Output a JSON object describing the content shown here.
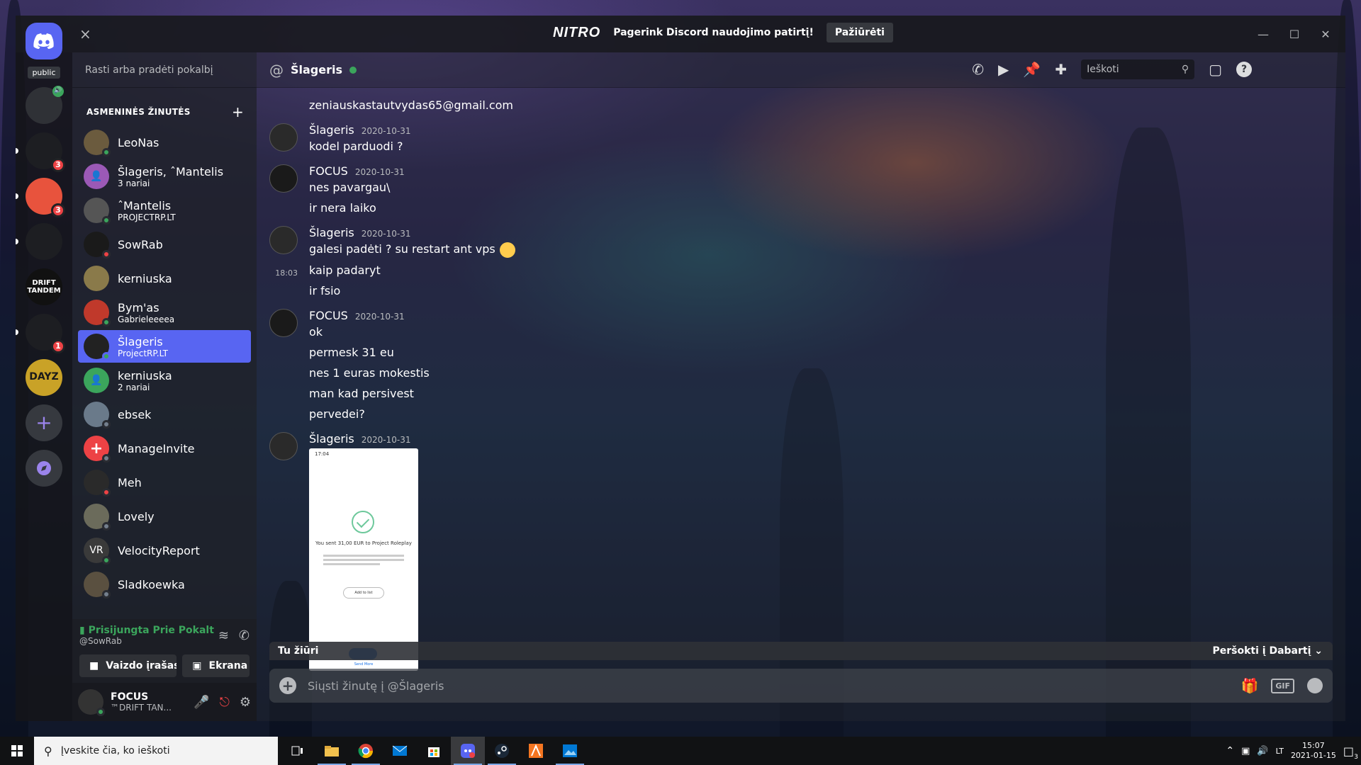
{
  "titlebar": {
    "nitro_logo": "NITRO",
    "nitro_promo": "Pagerink Discord naudojimo patirtį!",
    "nitro_button": "Pažiūrėti",
    "close_banner": "×"
  },
  "rail": {
    "public_label": "public",
    "servers": [
      {
        "name": "server-1",
        "badge": "",
        "color": "#2f3136"
      },
      {
        "name": "server-2",
        "badge": "3",
        "color": "#1d1e22"
      },
      {
        "name": "server-3",
        "badge": "3",
        "color": "#e8533d"
      },
      {
        "name": "server-4",
        "badge": "",
        "color": "#1d1e22"
      },
      {
        "name": "server-drift-tandem",
        "label": "DRIFT TANDEM",
        "badge": "",
        "color": "#111111"
      },
      {
        "name": "server-6",
        "badge": "1",
        "color": "#1d1e22"
      },
      {
        "name": "server-dayz",
        "label": "DAYZ",
        "badge": "",
        "color": "#c9a227"
      }
    ],
    "add_label": "+"
  },
  "dm": {
    "search_placeholder": "Rasti arba pradėti pokalbį",
    "header": "ASMENINĖS ŽINUTĖS",
    "items": [
      {
        "name": "LeoNas",
        "sub": "",
        "status": "online",
        "color": "#6b5b3e"
      },
      {
        "name": "Šlageris, ˆMantelis",
        "sub": "3 nariai",
        "status": "",
        "color": "#9b59b6"
      },
      {
        "name": "ˆMantelis",
        "sub": "PROJECTRP.LT",
        "status": "online",
        "color": "#555555"
      },
      {
        "name": "SowRab",
        "sub": "",
        "status": "dnd",
        "color": "#1a1a1a"
      },
      {
        "name": "kerniuska",
        "sub": "",
        "status": "",
        "color": "#8a7a4a"
      },
      {
        "name": "Bym'as",
        "sub": "Gabrieleeeea",
        "status": "online",
        "color": "#c0392b"
      },
      {
        "name": "Šlageris",
        "sub": "ProjectRP.LT",
        "status": "online",
        "color": "#222222",
        "active": true
      },
      {
        "name": "kerniuska",
        "sub": "2 nariai",
        "status": "",
        "color": "#3ba55c"
      },
      {
        "name": "ebsek",
        "sub": "",
        "status": "offline",
        "color": "#6a7a8a"
      },
      {
        "name": "ManageInvite",
        "sub": "",
        "status": "offline",
        "color": "#ed4245"
      },
      {
        "name": "Meh",
        "sub": "",
        "status": "dnd",
        "color": "#2a2a2a"
      },
      {
        "name": "Lovely",
        "sub": "",
        "status": "offline",
        "color": "#6b6b5b"
      },
      {
        "name": "VelocityReport",
        "sub": "",
        "status": "online",
        "color": "#3a3a3a",
        "initials": "VR"
      },
      {
        "name": "Sladkoewka",
        "sub": "",
        "status": "offline",
        "color": "#5a5040"
      }
    ],
    "voice": {
      "status": "Prisijungta Prie Pokalt",
      "channel": "@SowRab",
      "video_button": "Vaizdo įrašas",
      "screen_button": "Ekrana"
    },
    "user": {
      "name": "FOCUS",
      "tag": "™DRIFT TAN..."
    }
  },
  "chat": {
    "title": "Šlageris",
    "search_placeholder": "Ieškoti",
    "top_line": "zeniauskastautvydas65@gmail.com",
    "groups": [
      {
        "author": "Šlageris",
        "time": "2020-10-31",
        "lines": [
          "kodel parduodi ?"
        ]
      },
      {
        "author": "FOCUS",
        "time": "2020-10-31",
        "lines": [
          "nes pavargau\\",
          "ir nera laiko"
        ]
      },
      {
        "author": "Šlageris",
        "time": "2020-10-31",
        "lines": [
          "galesi padėti ? su restart ant vps",
          "kaip padaryt",
          "ir fsio"
        ],
        "inline_time": "18:03"
      },
      {
        "author": "FOCUS",
        "time": "2020-10-31",
        "lines": [
          "ok",
          "permesk 31 eu",
          "nes 1 euras mokestis",
          "man kad persivest",
          "pervedei?"
        ]
      },
      {
        "author": "Šlageris",
        "time": "2020-10-31",
        "lines": []
      }
    ],
    "attachment": {
      "status_time": "17:04",
      "title": "You sent 31,00 EUR to Project Roleplay",
      "button": "Add to list",
      "link": "Send More"
    },
    "jump_bar": {
      "left": "Tu žiūri",
      "right": "Peršokti į Dabartį"
    },
    "composer_placeholder": "Siųsti žinutę į @Šlageris",
    "gif_label": "GIF"
  },
  "taskbar": {
    "search_placeholder": "Įveskite čia, ko ieškoti",
    "lang": "LT",
    "time": "15:07",
    "date": "2021-01-15",
    "notif_count": "3"
  }
}
